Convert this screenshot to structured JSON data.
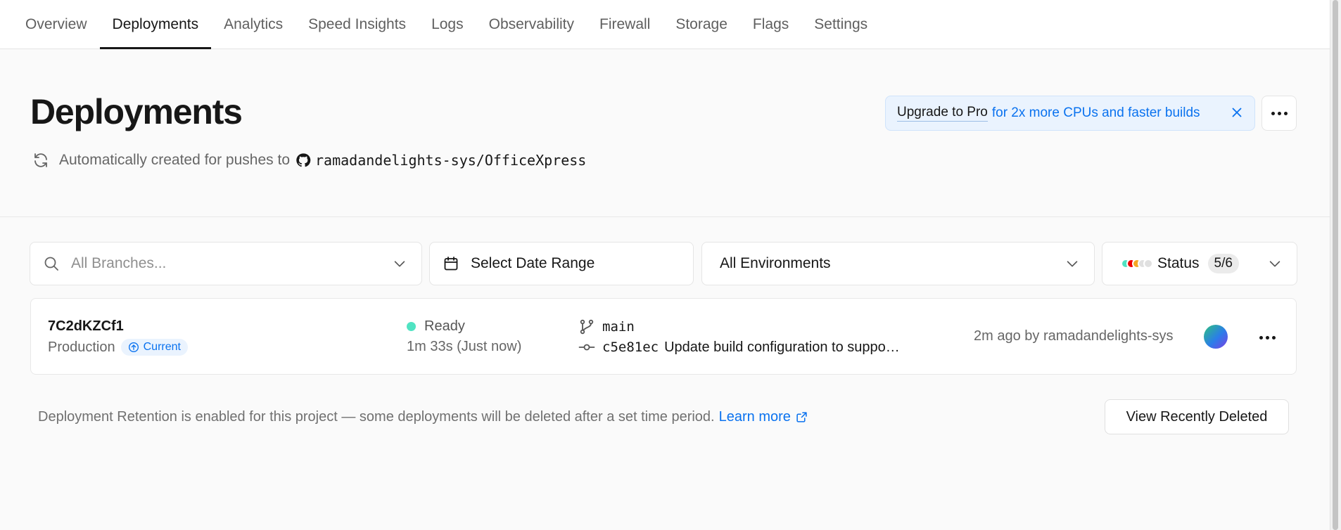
{
  "nav": {
    "tabs": [
      {
        "label": "Overview"
      },
      {
        "label": "Deployments",
        "active": true
      },
      {
        "label": "Analytics"
      },
      {
        "label": "Speed Insights"
      },
      {
        "label": "Logs"
      },
      {
        "label": "Observability"
      },
      {
        "label": "Firewall"
      },
      {
        "label": "Storage"
      },
      {
        "label": "Flags"
      },
      {
        "label": "Settings"
      }
    ]
  },
  "header": {
    "title": "Deployments",
    "auto_text": "Automatically created for pushes to",
    "repo": "ramadandelights-sys/OfficeXpress"
  },
  "upgrade_banner": {
    "strong": "Upgrade to Pro",
    "text": "for 2x more CPUs and faster builds"
  },
  "filters": {
    "branch_placeholder": "All Branches...",
    "date_label": "Select Date Range",
    "environment_label": "All Environments",
    "status_label": "Status",
    "status_count": "5/6",
    "status_colors": [
      "#50e3c2",
      "#ee0000",
      "#f5a623",
      "#e0e0e0",
      "#e0e0e0"
    ]
  },
  "deployment": {
    "id": "7C2dKZCf1",
    "environment": "Production",
    "badge": "Current",
    "status": "Ready",
    "status_color": "#50e3c2",
    "duration": "1m 33s (Just now)",
    "branch": "main",
    "commit_sha": "c5e81ec",
    "commit_message": "Update build configuration to suppo…",
    "meta": "2m ago by ramadandelights-sys"
  },
  "footer": {
    "retention_text": "Deployment Retention is enabled for this project — some deployments will be deleted after a set time period.",
    "learn_more": "Learn more",
    "view_deleted": "View Recently Deleted"
  },
  "colors": {
    "accent": "#0a72ef",
    "ready": "#50e3c2"
  }
}
